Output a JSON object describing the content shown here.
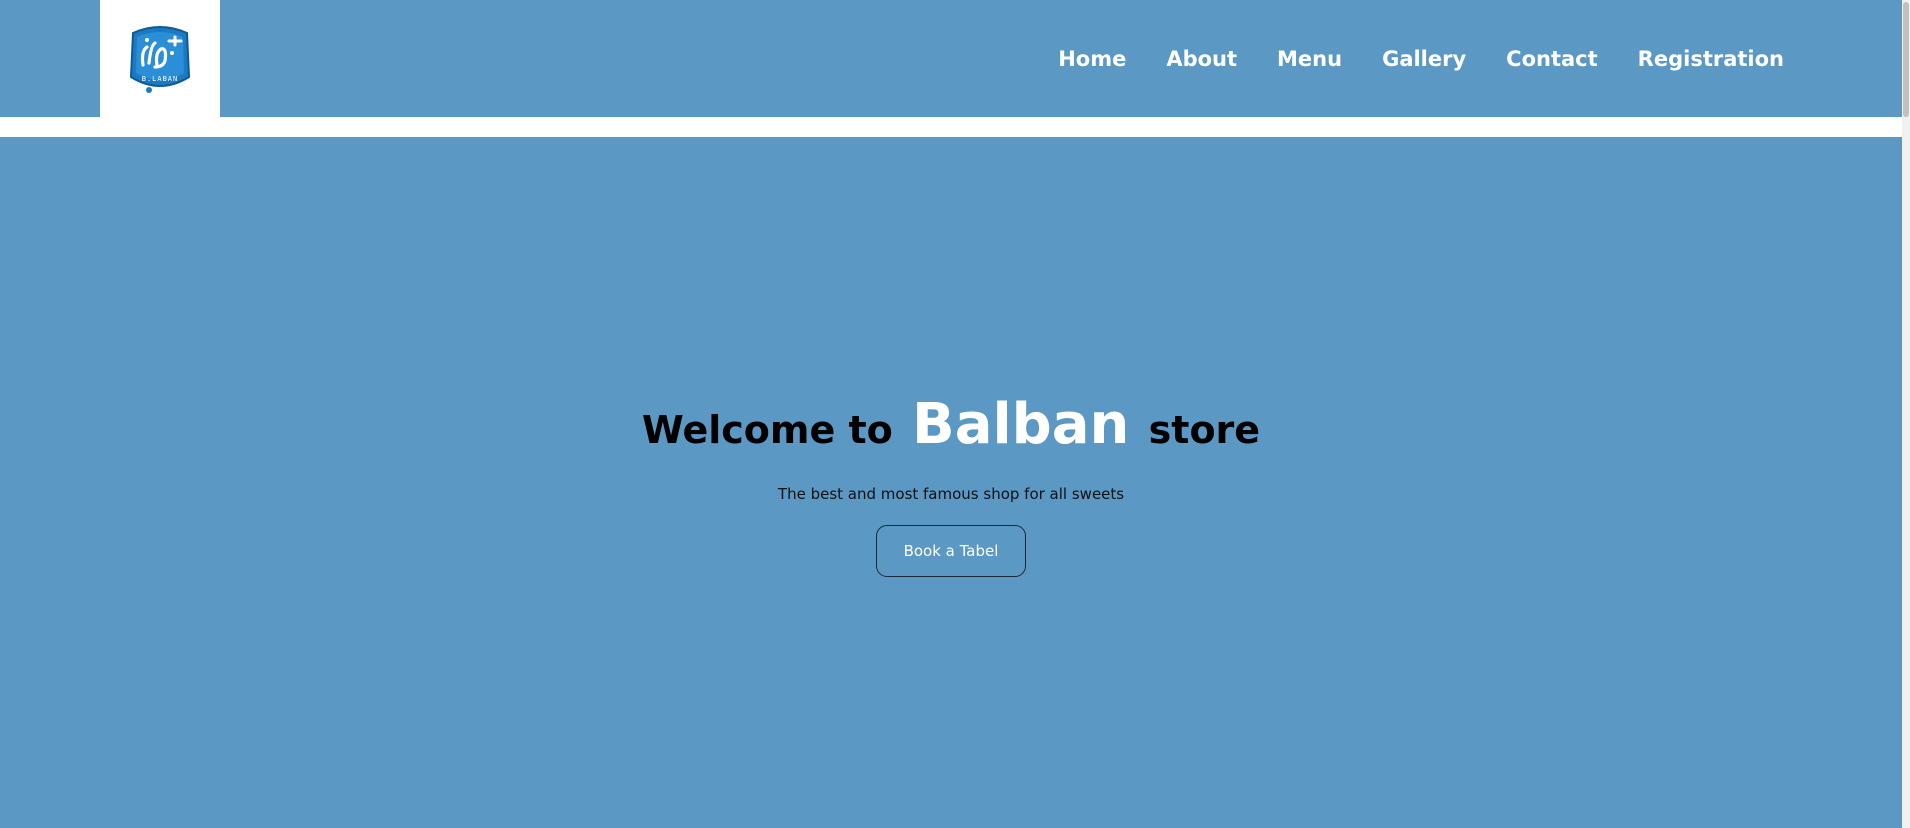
{
  "brand": {
    "logo_icon": "balban-logo-icon",
    "logo_text": "B.LABAN"
  },
  "nav": {
    "items": [
      {
        "label": "Home"
      },
      {
        "label": "About"
      },
      {
        "label": "Menu"
      },
      {
        "label": "Gallery"
      },
      {
        "label": "Contact"
      },
      {
        "label": "Registration"
      }
    ]
  },
  "hero": {
    "title_prefix": "Welcome to",
    "title_brand": "Balban",
    "title_suffix": "store",
    "subtitle": "The best and most famous shop for all sweets",
    "button_label": "Book a Tabel"
  },
  "colors": {
    "primary_blue": "#5b98c3",
    "logo_blue": "#1a7bc4",
    "text_dark": "#000000",
    "text_light": "#ffffff"
  }
}
